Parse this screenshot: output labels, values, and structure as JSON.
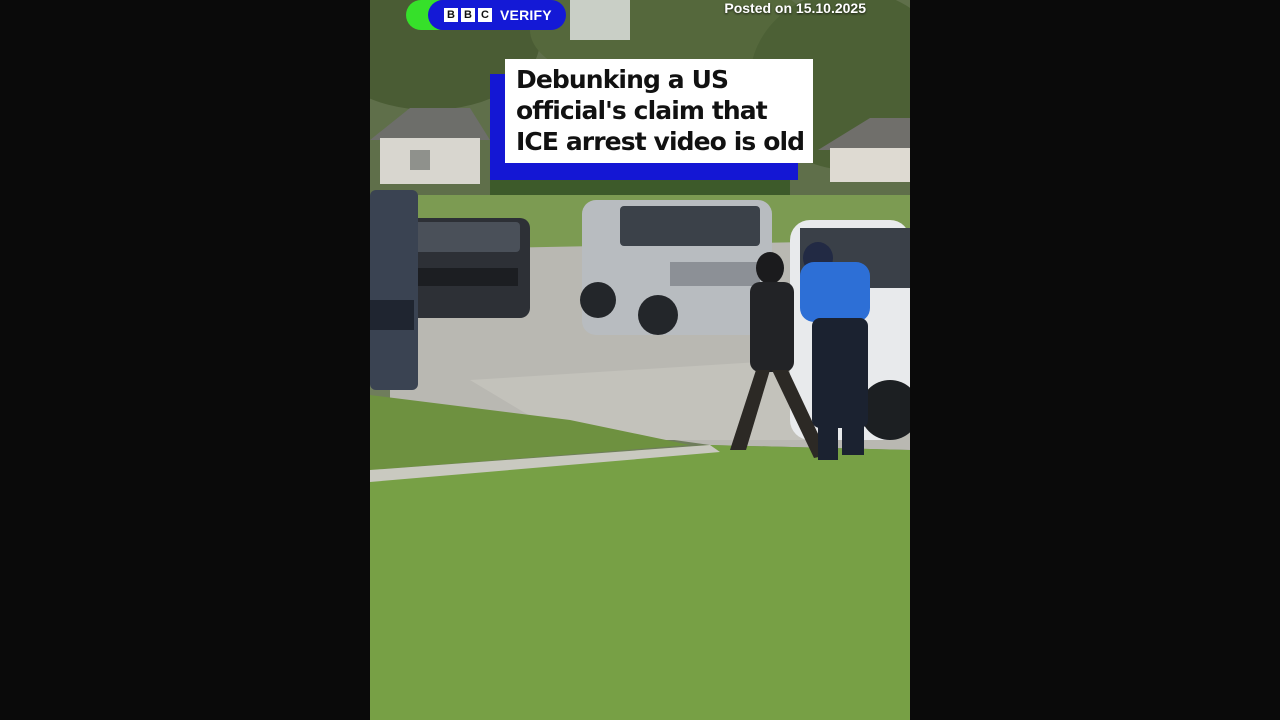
{
  "badge": {
    "letters": [
      "B",
      "B",
      "C"
    ],
    "label": "VERIFY",
    "colors": {
      "accent": "#36e02a",
      "brand": "#1419d6"
    }
  },
  "posted": "Posted on 15.10.2025",
  "headline": {
    "lines": [
      "Debunking a US",
      "official's claim that",
      "ICE arrest video is old"
    ]
  }
}
